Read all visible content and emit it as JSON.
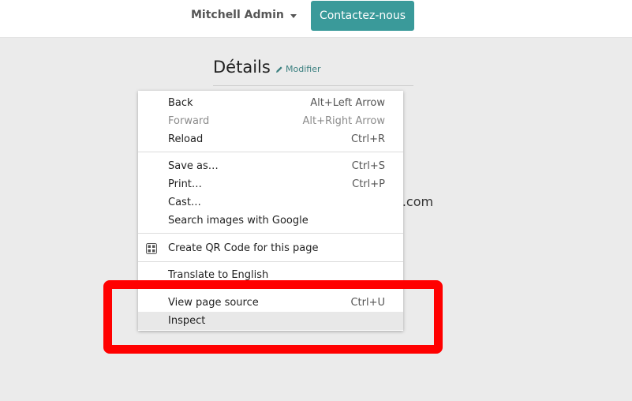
{
  "header": {
    "user_name": "Mitchell Admin",
    "contact_button": "Contactez-nous"
  },
  "details": {
    "title": "Détails",
    "edit_label": "Modifier",
    "email_fragment": "e.com"
  },
  "context_menu": {
    "back": {
      "label": "Back",
      "shortcut": "Alt+Left Arrow"
    },
    "forward": {
      "label": "Forward",
      "shortcut": "Alt+Right Arrow"
    },
    "reload": {
      "label": "Reload",
      "shortcut": "Ctrl+R"
    },
    "save_as": {
      "label": "Save as…",
      "shortcut": "Ctrl+S"
    },
    "print": {
      "label": "Print…",
      "shortcut": "Ctrl+P"
    },
    "cast": {
      "label": "Cast…"
    },
    "search_images": {
      "label": "Search images with Google"
    },
    "qr_code": {
      "label": "Create QR Code for this page"
    },
    "translate": {
      "label": "Translate to English"
    },
    "view_source": {
      "label": "View page source",
      "shortcut": "Ctrl+U"
    },
    "inspect": {
      "label": "Inspect"
    }
  },
  "colors": {
    "accent_button": "#3a9a9a",
    "highlight": "#ff0000"
  }
}
